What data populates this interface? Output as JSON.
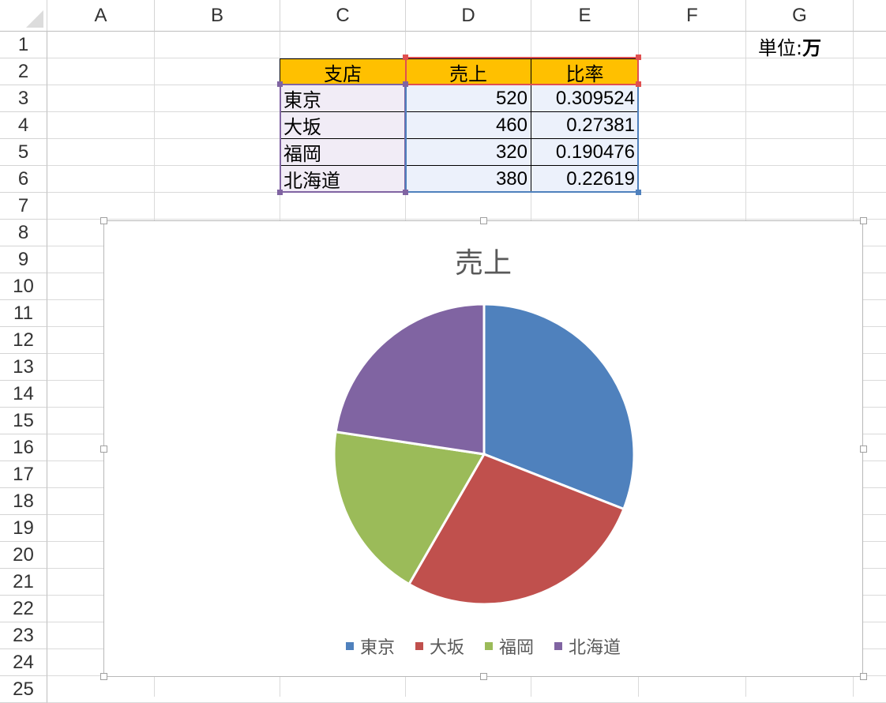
{
  "columns": [
    "A",
    "B",
    "C",
    "D",
    "E",
    "F",
    "G"
  ],
  "rows": [
    "1",
    "2",
    "3",
    "4",
    "5",
    "6",
    "7",
    "8",
    "9",
    "10",
    "11",
    "12",
    "13",
    "14",
    "15",
    "16",
    "17",
    "18",
    "19",
    "20",
    "21",
    "22",
    "23",
    "24",
    "25"
  ],
  "unit_label": "単位:",
  "unit_value": "万",
  "table": {
    "headers": [
      "支店",
      "売上",
      "比率"
    ],
    "rows": [
      {
        "branch": "東京",
        "sales": "520",
        "ratio": "0.309524"
      },
      {
        "branch": "大坂",
        "sales": "460",
        "ratio": "0.27381"
      },
      {
        "branch": "福岡",
        "sales": "320",
        "ratio": "0.190476"
      },
      {
        "branch": "北海道",
        "sales": "380",
        "ratio": "0.22619"
      }
    ]
  },
  "colors": {
    "header_fill": "#ffc000",
    "range_purple": "#8064a2",
    "range_blue": "#4f81bd",
    "range_red": "#e05050"
  },
  "chart_data": {
    "type": "pie",
    "title": "売上",
    "categories": [
      "東京",
      "大坂",
      "福岡",
      "北海道"
    ],
    "values": [
      520,
      460,
      320,
      380
    ],
    "colors": [
      "#4f81bd",
      "#c0504d",
      "#9bbb59",
      "#8064a2"
    ],
    "legend_position": "bottom"
  }
}
